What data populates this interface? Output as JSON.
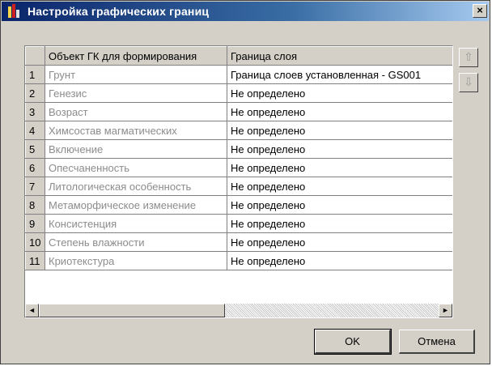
{
  "window": {
    "title": "Настройка графических границ",
    "close_label": "×"
  },
  "grid": {
    "headers": [
      "",
      "Объект ГК для формирования",
      "Граница слоя"
    ],
    "rows": [
      {
        "num": "1",
        "object": "Грунт",
        "boundary": "Граница слоев установленная - GS001"
      },
      {
        "num": "2",
        "object": "Генезис",
        "boundary": "Не определено"
      },
      {
        "num": "3",
        "object": "Возраст",
        "boundary": "Не определено"
      },
      {
        "num": "4",
        "object": "Химсостав магматических",
        "boundary": "Не определено"
      },
      {
        "num": "5",
        "object": "Включение",
        "boundary": "Не определено"
      },
      {
        "num": "6",
        "object": "Опесчаненность",
        "boundary": "Не определено"
      },
      {
        "num": "7",
        "object": "Литологическая особенность",
        "boundary": "Не определено"
      },
      {
        "num": "8",
        "object": "Метаморфическое изменение",
        "boundary": "Не определено"
      },
      {
        "num": "9",
        "object": "Консистенция",
        "boundary": "Не определено"
      },
      {
        "num": "10",
        "object": "Степень влажности",
        "boundary": "Не определено"
      },
      {
        "num": "11",
        "object": "Криотекстура",
        "boundary": "Не определено"
      }
    ]
  },
  "scrollbar": {
    "left_arrow": "◄",
    "right_arrow": "►"
  },
  "side_buttons": {
    "up_icon": "⇧",
    "down_icon": "⇩"
  },
  "buttons": {
    "ok_label": "OK",
    "cancel_label": "Отмена"
  },
  "colors": {
    "title_gradient_start": "#0a246a",
    "title_gradient_end": "#a6caf0",
    "face": "#d4d0c8",
    "object_text": "#8c8c8c"
  }
}
